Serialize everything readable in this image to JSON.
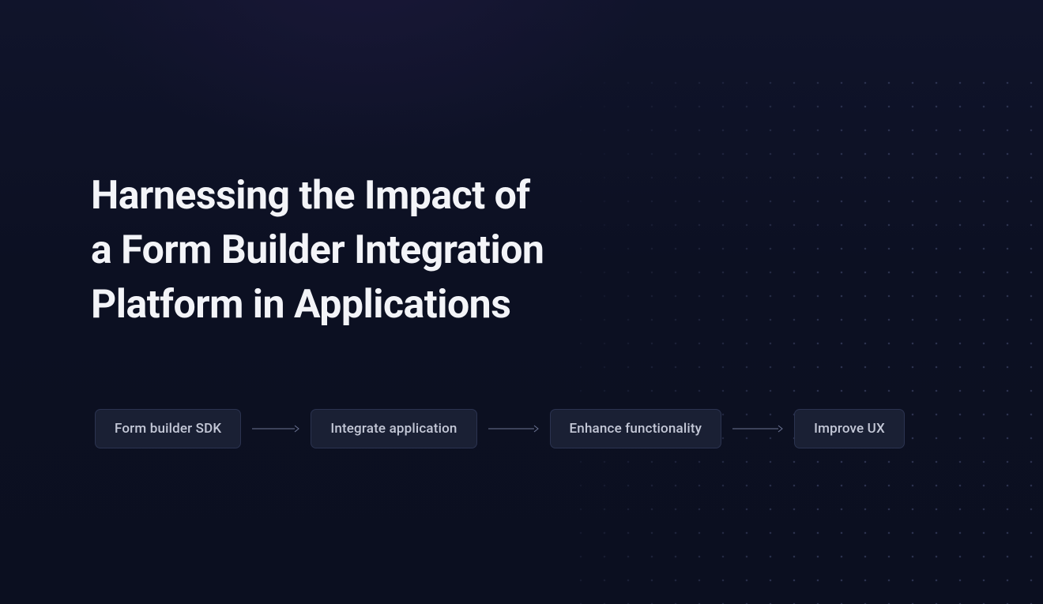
{
  "title": "Harnessing the Impact of\na Form Builder Integration\nPlatform in Applications",
  "flow": {
    "steps": [
      {
        "label": "Form builder SDK"
      },
      {
        "label": "Integrate application"
      },
      {
        "label": "Enhance functionality"
      },
      {
        "label": "Improve UX"
      }
    ]
  },
  "arrow_lengths": [
    56,
    60,
    60
  ]
}
